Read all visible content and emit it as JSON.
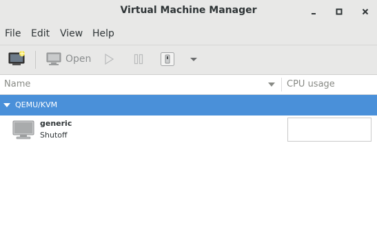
{
  "window": {
    "title": "Virtual Machine Manager",
    "controls": {
      "minimize": "‒",
      "maximize": "□",
      "close": "✕"
    }
  },
  "menu": {
    "items": [
      "File",
      "Edit",
      "View",
      "Help"
    ]
  },
  "toolbar": {
    "new_vm_icon": "new-vm-icon",
    "open_label": "Open",
    "run_icon": "play-icon",
    "pause_icon": "pause-icon",
    "shutdown_icon": "power-icon",
    "dropdown_icon": "chevron-down-icon"
  },
  "list": {
    "columns": {
      "name": "Name",
      "cpu": "CPU usage"
    },
    "group": {
      "label": "QEMU/KVM",
      "expanded": true
    },
    "vms": [
      {
        "name": "generic",
        "status": "Shutoff",
        "icon": "monitor-icon"
      }
    ]
  },
  "colors": {
    "selection": "#4a90d9",
    "chrome": "#e8e8e7",
    "text": "#2e3436"
  }
}
